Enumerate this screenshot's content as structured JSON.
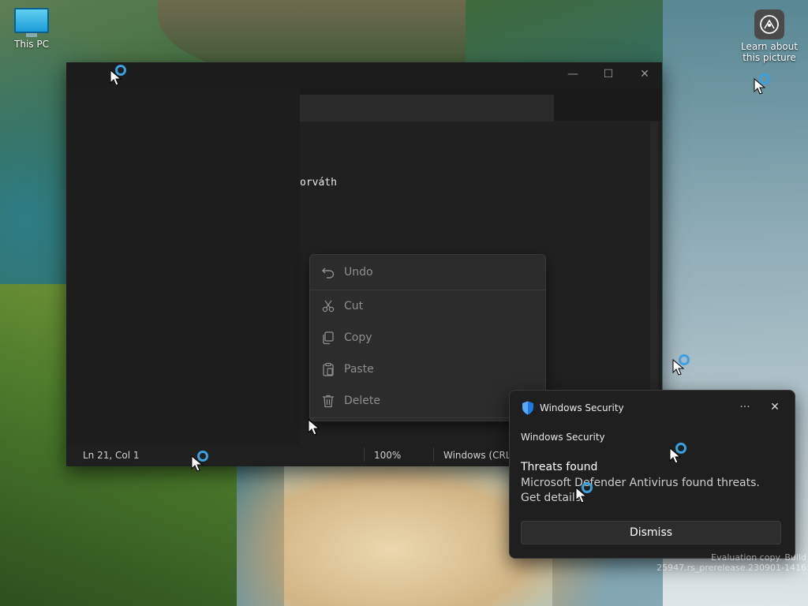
{
  "desktop": {
    "icons": [
      {
        "label": "This PC",
        "icon": "computer-icon"
      },
      {
        "label": "Learn about this picture",
        "icon": "learn-about-picture-icon"
      }
    ],
    "watermark": "Evaluation copy. Build 25947.rs_prerelease.230901-1416"
  },
  "notepad": {
    "window_controls": {
      "minimize": "—",
      "maximize": "☐",
      "close": "✕"
    },
    "visible_text": "orváth",
    "status": {
      "position": "Ln 21, Col 1",
      "zoom": "100%",
      "line_ending": "Windows (CRLF"
    }
  },
  "context_menu": {
    "items": [
      {
        "label": "Undo",
        "icon": "undo-icon",
        "enabled": false
      },
      {
        "label": "Cut",
        "icon": "scissors-icon",
        "enabled": false
      },
      {
        "label": "Copy",
        "icon": "copy-icon",
        "enabled": false
      },
      {
        "label": "Paste",
        "icon": "paste-icon",
        "enabled": false
      },
      {
        "label": "Delete",
        "icon": "trash-icon",
        "enabled": false
      }
    ]
  },
  "toast": {
    "app_name": "Windows Security",
    "attribution": "Windows Security",
    "heading": "Threats found",
    "body": "Microsoft Defender Antivirus found threats. Get details.",
    "more_label": "···",
    "close_label": "✕",
    "dismiss_label": "Dismiss",
    "colors": {
      "shield": "#1f7ae0"
    }
  }
}
